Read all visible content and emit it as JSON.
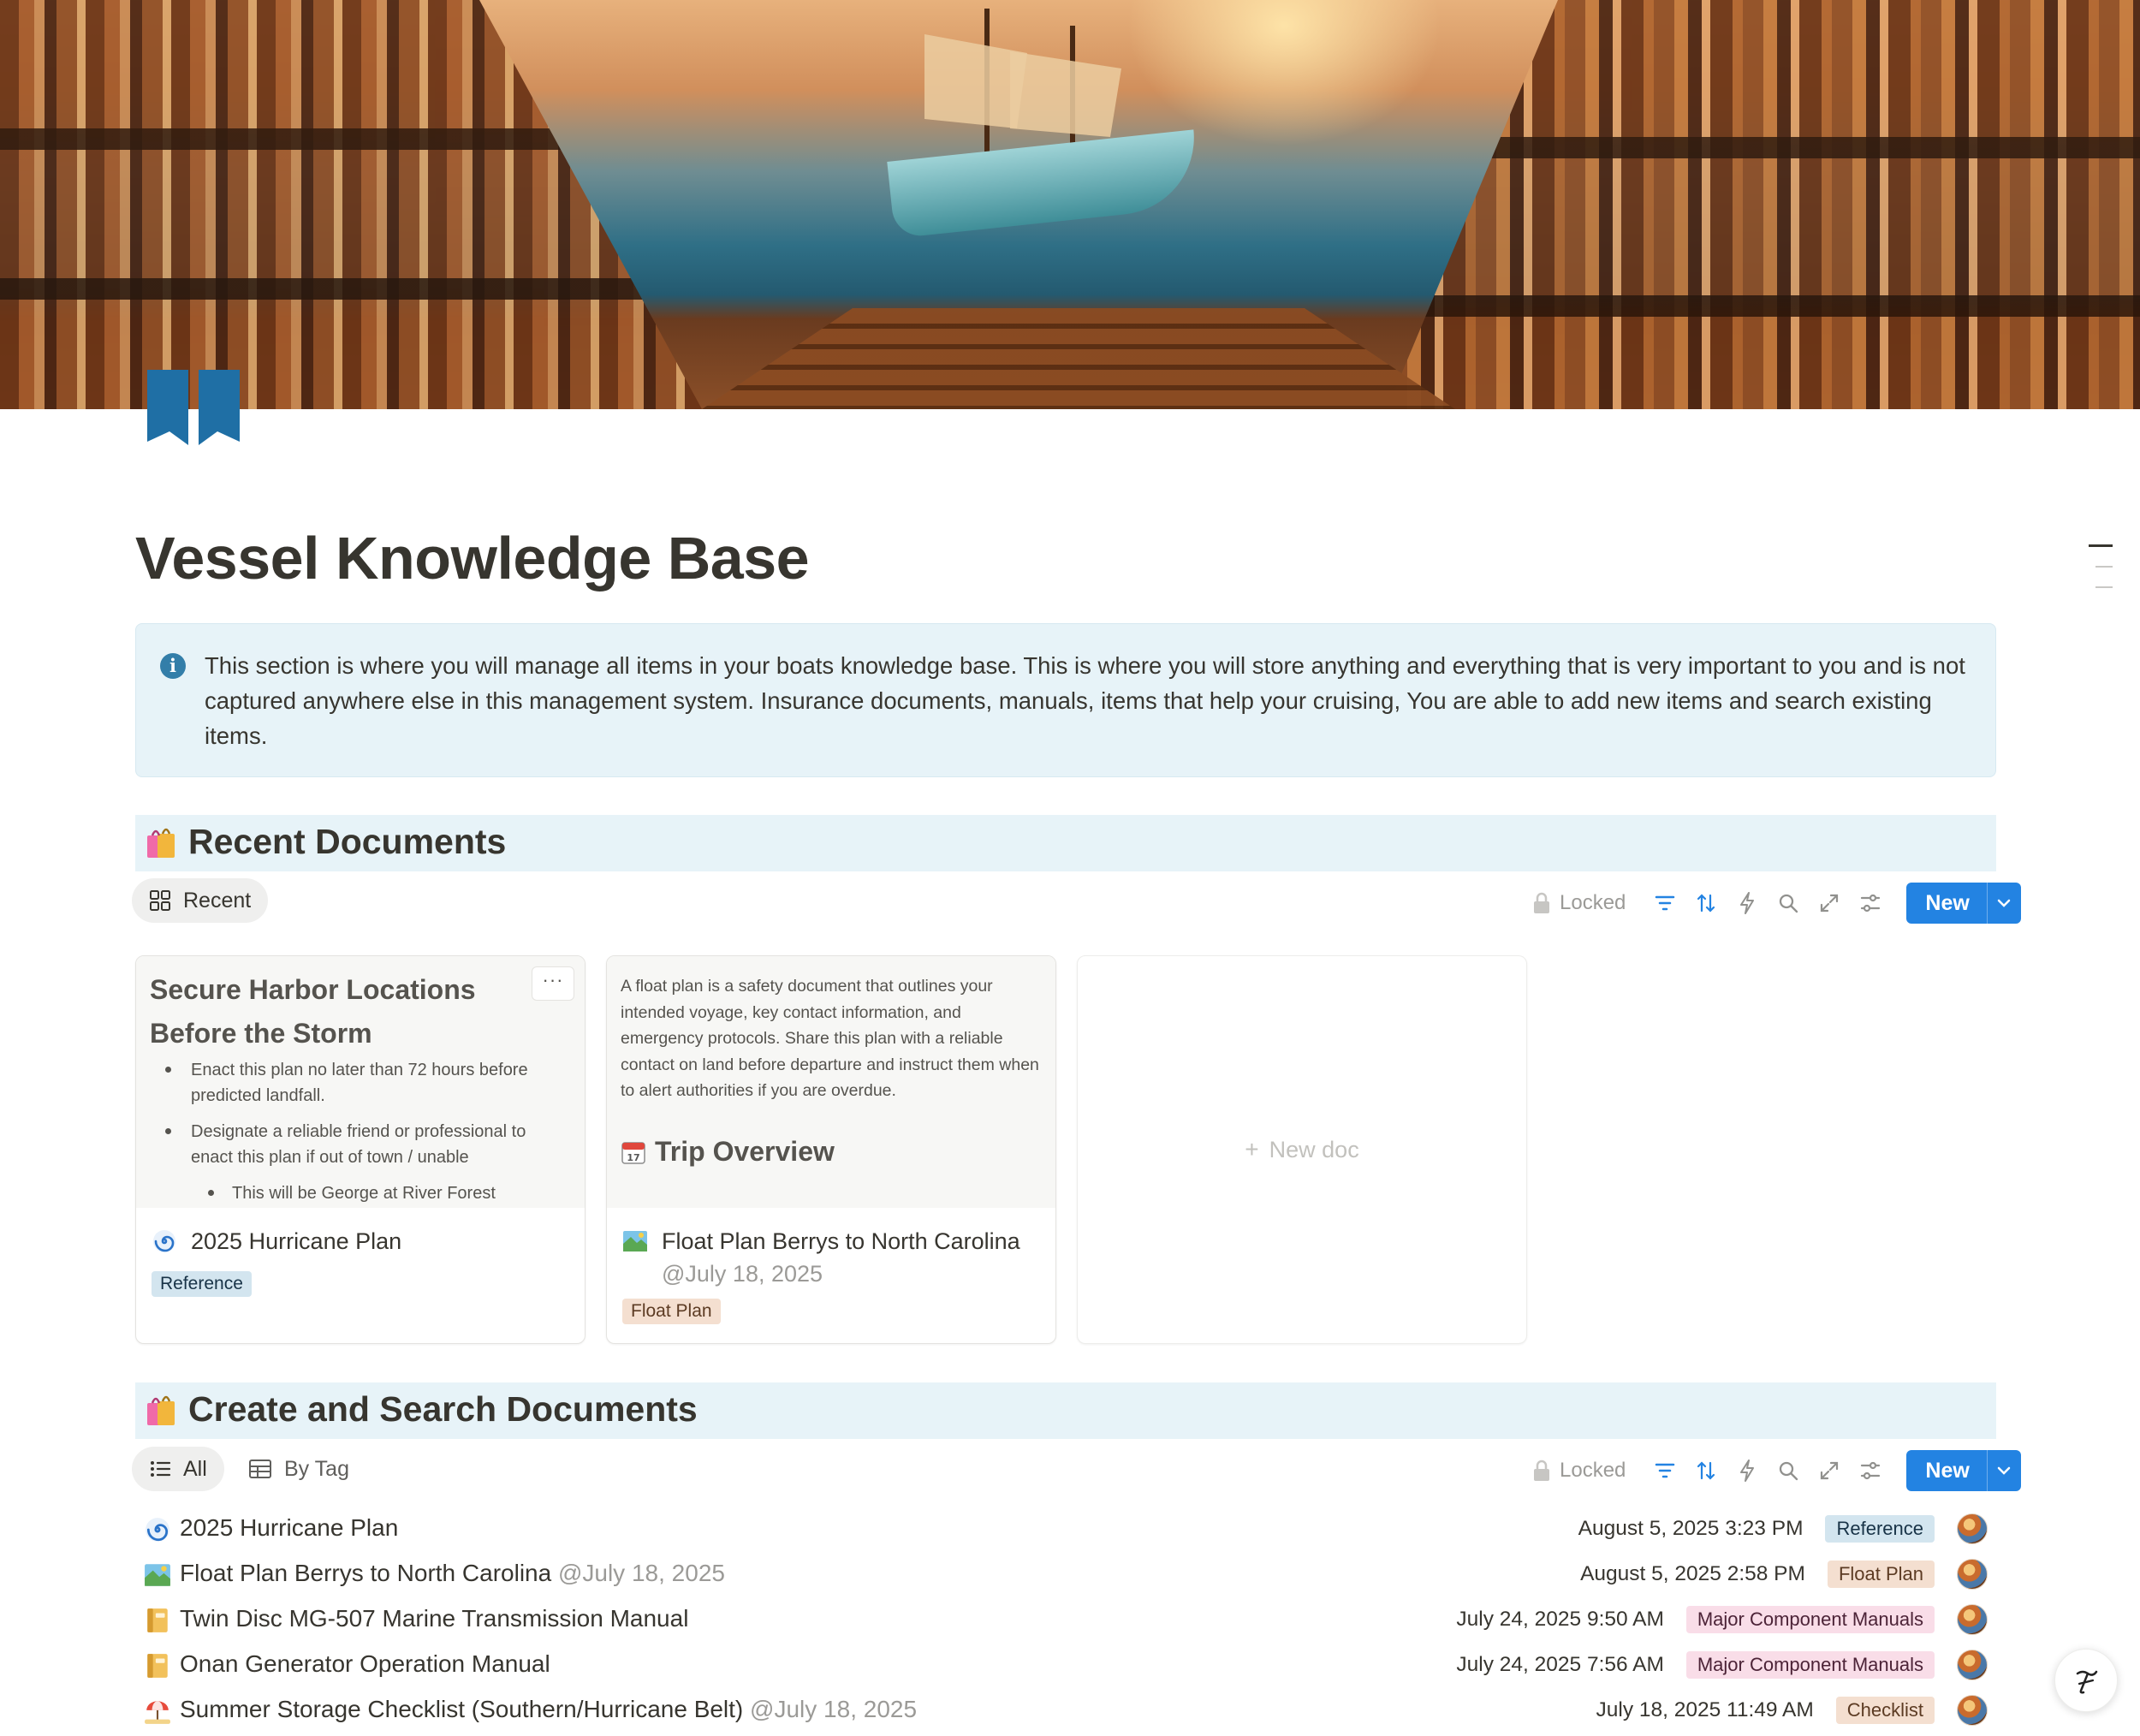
{
  "page": {
    "title": "Vessel Knowledge Base",
    "icon": "book-icon"
  },
  "callout": {
    "icon": "info-icon",
    "text": "This section is where you will manage all items in your boats knowledge base. This is where you will store anything and everything that is very important to you and is not captured anywhere else in this management system. Insurance documents, manuals, items that help your cruising, You are able to add new items and search existing items."
  },
  "recent_section": {
    "heading": "Recent Documents",
    "heading_icon": "shopping-bags-icon",
    "view_tab": "Recent",
    "toolbar": {
      "locked_label": "Locked",
      "new_label": "New"
    },
    "cards": [
      {
        "preview_heading": "Secure Harbor Locations Before the Storm",
        "preview_bullets": [
          "Enact this plan no later than 72 hours before predicted landfall.",
          "Designate a reliable friend or professional to enact this plan if out of town / unable"
        ],
        "preview_subbullet": "This will be George at River Forest",
        "icon": "cyclone-icon",
        "title": "2025 Hurricane Plan",
        "tag": "Reference"
      },
      {
        "preview_text": "A float plan is a safety document that outlines your intended voyage, key contact information, and emergency protocols. Share this plan with a reliable contact on land before departure and instruct them when to alert authorities if you are overdue.",
        "preview_heading": "Trip Overview",
        "preview_heading_icon": "calendar-icon",
        "icon": "map-icon",
        "title": "Float Plan Berrys to North Carolina",
        "mention": "@July 18, 2025",
        "tag": "Float Plan"
      }
    ],
    "new_doc_label": "New doc"
  },
  "search_section": {
    "heading": "Create and Search Documents",
    "heading_icon": "shopping-bags-icon",
    "tabs": [
      {
        "label": "All",
        "icon": "list-icon",
        "active": true
      },
      {
        "label": "By Tag",
        "icon": "table-icon",
        "active": false
      }
    ],
    "toolbar": {
      "locked_label": "Locked",
      "new_label": "New"
    },
    "rows": [
      {
        "icon": "cyclone-icon",
        "name": "2025 Hurricane Plan",
        "mention": "",
        "date": "August 5, 2025 3:23 PM",
        "tag": "Reference",
        "tag_style": "reference"
      },
      {
        "icon": "map-icon",
        "name": "Float Plan Berrys to North Carolina",
        "mention": "@July 18, 2025",
        "date": "August 5, 2025 2:58 PM",
        "tag": "Float Plan",
        "tag_style": "floatplan"
      },
      {
        "icon": "notebook-icon",
        "name": "Twin Disc MG-507 Marine Transmission Manual",
        "mention": "",
        "date": "July 24, 2025 9:50 AM",
        "tag": "Major Component Manuals",
        "tag_style": "manuals"
      },
      {
        "icon": "notebook-icon",
        "name": "Onan Generator Operation Manual",
        "mention": "",
        "date": "July 24, 2025 7:56 AM",
        "tag": "Major Component Manuals",
        "tag_style": "manuals"
      },
      {
        "icon": "beach-umbrella-icon",
        "name": "Summer Storage Checklist (Southern/Hurricane Belt)",
        "mention": "@July 18, 2025",
        "date": "July 18, 2025 11:49 AM",
        "tag": "Checklist",
        "tag_style": "checklist"
      }
    ]
  },
  "colors": {
    "accent": "#2383e2",
    "callout_bg": "#e7f3f8",
    "info_icon": "#337ea9",
    "tag_reference": "#d3e5ef",
    "tag_floatplan": "#f4dfd0",
    "tag_manuals": "#f9dde8"
  }
}
